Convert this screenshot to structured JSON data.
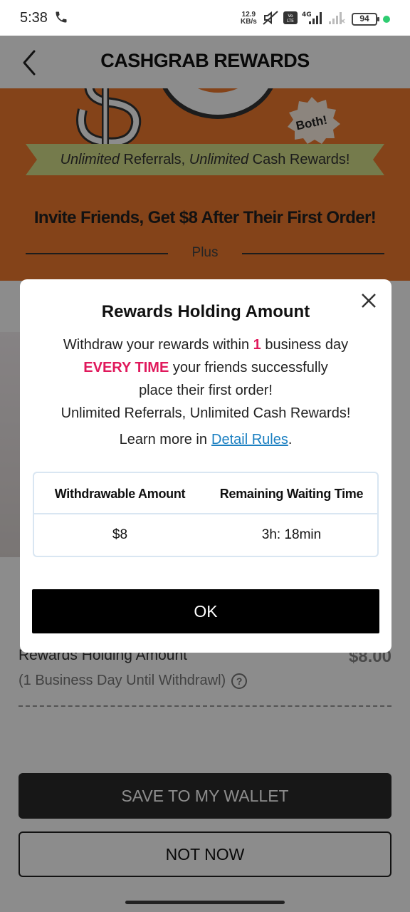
{
  "status_bar": {
    "time": "5:38",
    "net_speed_top": "12.9",
    "net_speed_unit": "KB/s",
    "volte": "Vo LTE",
    "network": "4G",
    "battery": "94"
  },
  "header": {
    "title": "CASHGRAB REWARDS"
  },
  "hero": {
    "badge": "Both!",
    "ribbon_italic_1": "Unlimited",
    "ribbon_text_1": " Referrals, ",
    "ribbon_italic_2": "Unlimited",
    "ribbon_text_2": " Cash Rewards!",
    "invite": "Invite Friends, Get $8 After Their First Order!",
    "plus": "Plus"
  },
  "background": {
    "holding_label": "Rewards Holding Amount",
    "holding_amount": "$8.00",
    "holding_sub": "(1 Business Day Until Withdrawl)",
    "save_button": "SAVE TO MY WALLET",
    "not_now_button": "NOT NOW"
  },
  "modal": {
    "title": "Rewards Holding Amount",
    "line1_a": "Withdraw your rewards within ",
    "line1_num": "1",
    "line1_b": " business day",
    "line2_red": "EVERY TIME",
    "line2_rest": " your friends successfully",
    "line3": "place their first order!",
    "line4": "Unlimited Referrals, Unlimited Cash Rewards!",
    "learn_prefix": "Learn more in",
    "learn_link": "Detail Rules",
    "learn_suffix": ".",
    "table": {
      "headers": [
        "Withdrawable Amount",
        "Remaining Waiting Time"
      ],
      "rows": [
        [
          "$8",
          "3h: 18min"
        ]
      ]
    },
    "ok_button": "OK"
  }
}
